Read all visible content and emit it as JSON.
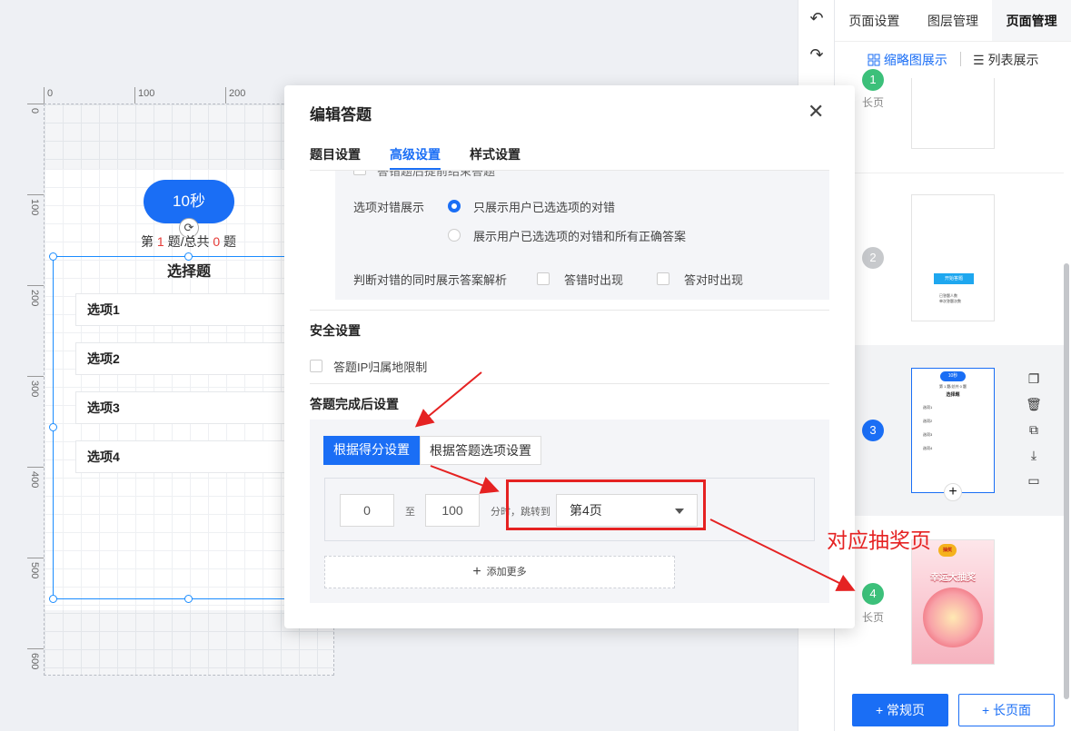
{
  "canvas": {
    "ruler_h": [
      "0",
      "100",
      "200"
    ],
    "ruler_v": [
      "0",
      "100",
      "200",
      "300",
      "400",
      "500",
      "600"
    ],
    "timer_label": "10秒",
    "progress": {
      "prefix": "第",
      "current": "1",
      "mid": "题/总共",
      "total": "0",
      "suffix": "题"
    },
    "question_title": "选择题",
    "options": [
      "选项1",
      "选项2",
      "选项3",
      "选项4"
    ]
  },
  "toolbar": {
    "undo_icon": "undo-icon",
    "redo_icon": "redo-icon"
  },
  "right_panel": {
    "tabs": [
      "页面设置",
      "图层管理",
      "页面管理"
    ],
    "active_tab": 2,
    "view_thumbnail": "缩略图展示",
    "view_list": "列表展示",
    "pages": [
      {
        "num": "1",
        "label": "长页",
        "color": "#3cc07a"
      },
      {
        "num": "2",
        "label": "",
        "color": "#c7c9cc"
      },
      {
        "num": "3",
        "label": "",
        "color": "#1a6ef5"
      },
      {
        "num": "4",
        "label": "长页",
        "color": "#3cc07a"
      }
    ],
    "thumb3": {
      "timer": "10秒",
      "progress": "第 1 题/总共 0 题",
      "title": "选择题",
      "options": [
        "选项1",
        "选项2",
        "选项3",
        "选项4"
      ]
    },
    "thumb2": {
      "button": "开始答题",
      "line1": "已答题人数",
      "line2": "单次答题次数"
    },
    "thumb4": {
      "badge": "抽奖",
      "title": "幸运大抽奖"
    },
    "side_icons": [
      "copy-icon",
      "trash-icon",
      "duplicate-icon",
      "download-icon",
      "folder-icon"
    ],
    "btn_regular": "+ 常规页",
    "btn_long": "+ 长页面"
  },
  "modal": {
    "title": "编辑答题",
    "tabs": [
      "题目设置",
      "高级设置",
      "样式设置"
    ],
    "active_tab": 1,
    "cut_text": "答错题后提前结束答题",
    "show_correct_label": "选项对错展示",
    "radio1": "只展示用户已选选项的对错",
    "radio2": "展示用户已选选项的对错和所有正确答案",
    "analysis_label": "判断对错的同时展示答案解析",
    "chk_wrong": "答错时出现",
    "chk_right": "答对时出现",
    "security_title": "安全设置",
    "ip_limit": "答题IP归属地限制",
    "after_title": "答题完成后设置",
    "seg_score": "根据得分设置",
    "seg_option": "根据答题选项设置",
    "min_score": "0",
    "to": "至",
    "max_score": "100",
    "score_unit": "分时，跳转到",
    "jump_page": "第4页",
    "add_more": "添加更多"
  },
  "annotation": "对应抽奖页",
  "colors": {
    "accent": "#1a6ef5",
    "annotation": "#e52222"
  }
}
